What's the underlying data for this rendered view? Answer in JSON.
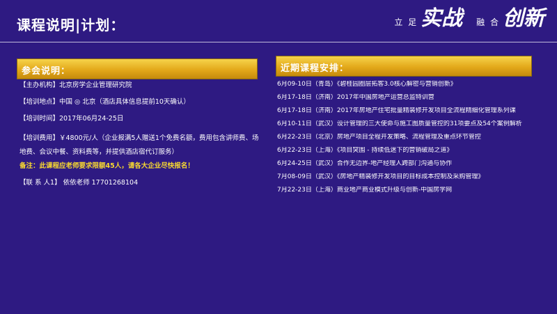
{
  "header": {
    "title": "课程说明|计划：",
    "slogan": {
      "part1_small": "立 足",
      "part1_big": "实战",
      "part2_small": "融 合",
      "part2_big": "创新"
    }
  },
  "left_panel": {
    "heading": "参会说明：",
    "rows": [
      "【主办机构】北京房学企业管理研究院",
      "【培训地点】中国 ◎ 北京（酒店具体信息提前10天确认）",
      "【培训时间】2017年06月24-25日",
      "【培训费用】￥4800元/人（企业报满5人赠送1个免费名额，费用包含讲师费、场地费、会议中餐、资料费等，并提供酒店宿代订服务）",
      "备注：此课程应老师要求限额45人，请各大企业尽快报名！",
      "【联 系 人1】 依依老师 17701268104"
    ]
  },
  "right_panel": {
    "heading": "近期课程安排：",
    "items": [
      "6月09-10日（青岛）《碧桂园圈层拓客3.0核心解密与营销创新》",
      "6月17-18日（济南）2017年中国房地产运营总监特训营",
      "6月17-18日（济南）2017年房地产住宅批量精装修开发项目全流程精细化管理系列课",
      "6月10-11日（武汉）设计管理的三大使命与施工图质量管控的31项要点及54个案例解析",
      "6月22-23日（北京）房地产项目全程开发策略、流程管理及重点环节管控",
      "6月22-23日（上海）《项目突围 - 持续低迷下的营销破局之道》",
      "6月24-25日（武汉）合作无边界-地产经理人跨部门沟通与协作",
      "7月08-09日（武汉）《房地产精装修开发项目的目标成本控制及采购管理》",
      "7月22-23日（上海）商业地产商业模式升级与创新-中国房学网"
    ]
  },
  "colors": {
    "background": "#2e1a82",
    "bar_gold": "#e3a81a",
    "note_yellow": "#f8d830"
  }
}
